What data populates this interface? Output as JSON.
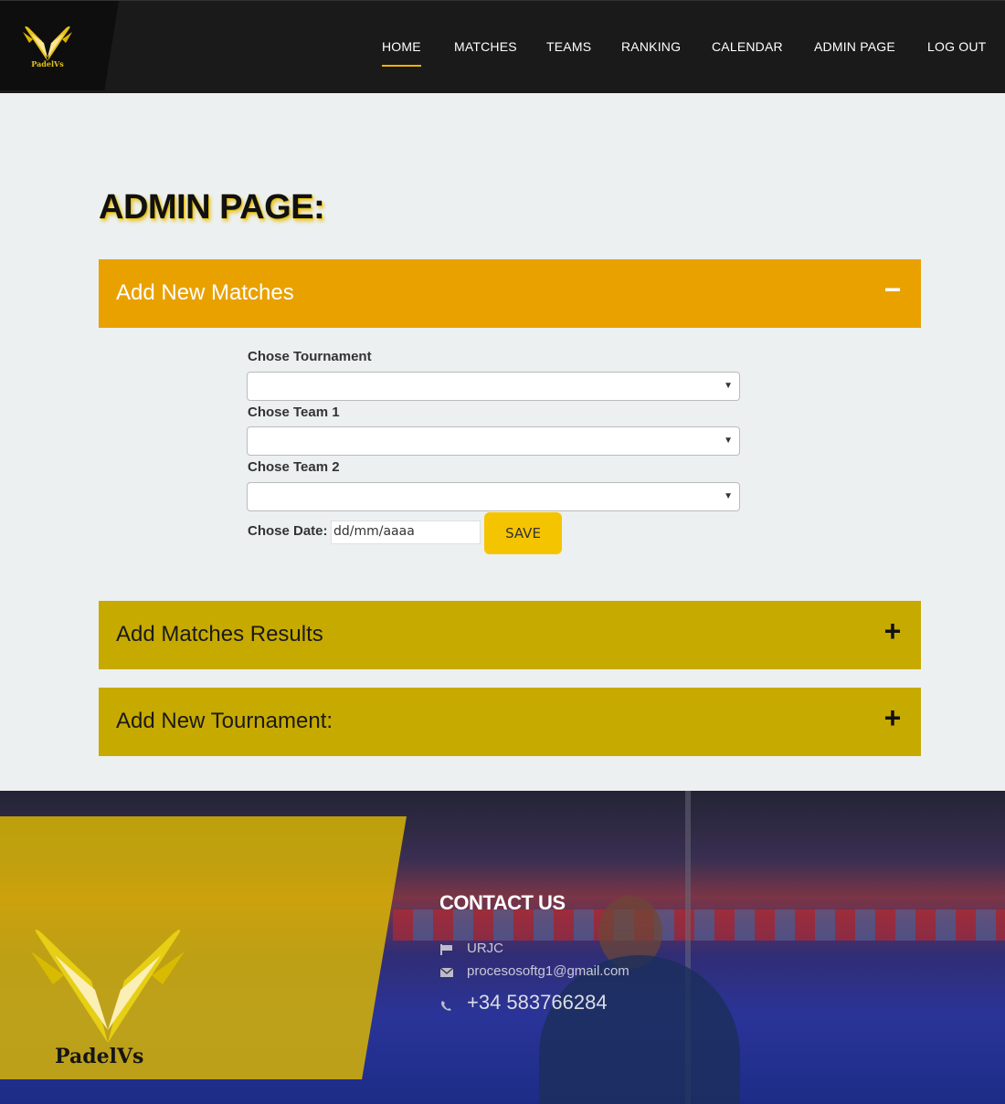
{
  "header": {
    "logo_text": "PadelVs",
    "nav": [
      {
        "label": "HOME",
        "active": true
      },
      {
        "label": "MATCHES",
        "active": false
      },
      {
        "label": "TEAMS",
        "active": false
      },
      {
        "label": "RANKING",
        "active": false
      },
      {
        "label": "CALENDAR",
        "active": false
      },
      {
        "label": "ADMIN PAGE",
        "active": false
      },
      {
        "label": "LOG OUT",
        "active": false
      }
    ]
  },
  "page": {
    "title": "ADMIN PAGE:"
  },
  "sections": [
    {
      "label": "Add New Matches",
      "expanded": true,
      "toggle": "−"
    },
    {
      "label": "Add Matches Results",
      "expanded": false,
      "toggle": "+"
    },
    {
      "label": "Add New Tournament:",
      "expanded": false,
      "toggle": "+"
    }
  ],
  "form": {
    "tournament_label": "Chose Tournament",
    "tournament_value": "",
    "team1_label": "Chose Team 1",
    "team1_value": "",
    "team2_label": "Chose Team 2",
    "team2_value": "",
    "date_label": "Chose Date:",
    "date_placeholder": "dd/mm/aaaa",
    "save_label": "SAVE"
  },
  "footer": {
    "logo_text": "PadelVs",
    "contact_title": "CONTACT US",
    "address": "URJC",
    "email": "procesosoftg1@gmail.com",
    "phone": "+34 583766284"
  },
  "colors": {
    "header_bg": "#1a1a1a",
    "accent": "#f0b400",
    "section_open": "#e9a100",
    "section_closed": "#c7aa00",
    "save_button": "#f5c400"
  }
}
